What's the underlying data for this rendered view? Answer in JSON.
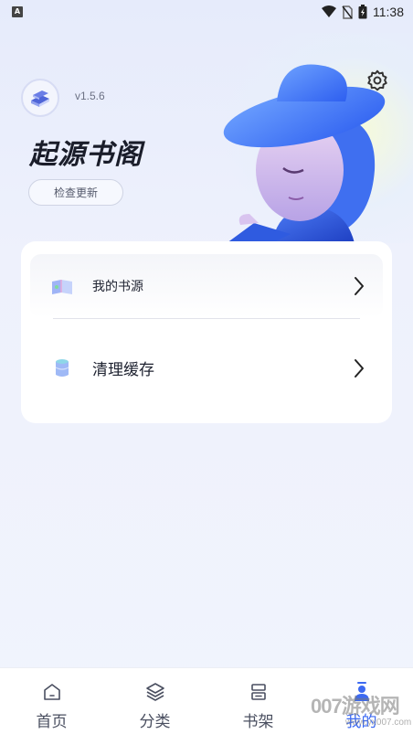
{
  "status_bar": {
    "app_indicator": "A",
    "time": "11:38",
    "icons": [
      "wifi-icon",
      "no-sim-icon",
      "battery-charging-icon"
    ]
  },
  "header": {
    "version": "v1.5.6",
    "app_name": "起源书阁",
    "check_update_label": "检查更新",
    "settings_icon": "gear-icon"
  },
  "menu": {
    "items": [
      {
        "label": "我的书源",
        "icon": "book-source-icon"
      },
      {
        "label": "清理缓存",
        "icon": "clear-cache-icon"
      }
    ]
  },
  "bottom_nav": {
    "items": [
      {
        "label": "首页",
        "icon": "home-icon"
      },
      {
        "label": "分类",
        "icon": "layers-icon"
      },
      {
        "label": "书架",
        "icon": "bookshelf-icon"
      },
      {
        "label": "我的",
        "icon": "person-icon",
        "active": true
      }
    ],
    "active_color": "#3d6af2"
  },
  "watermark": {
    "text": "007游戏网",
    "url": "www.yx007.com"
  }
}
